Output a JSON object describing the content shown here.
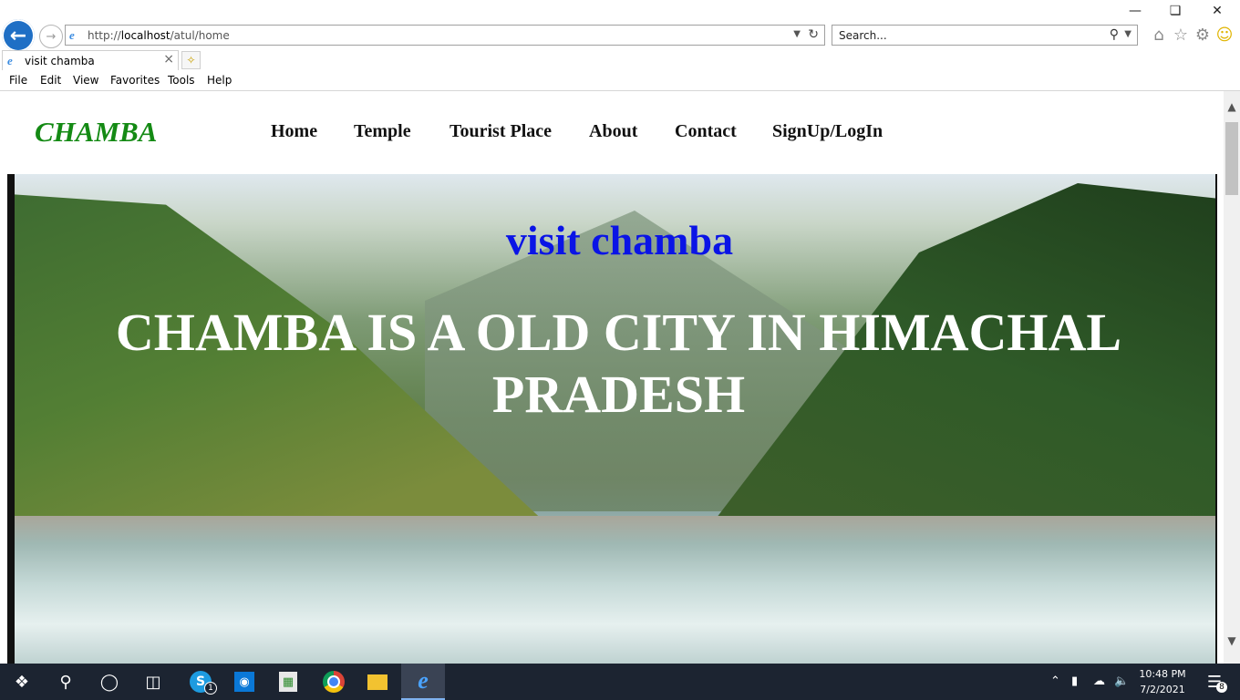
{
  "browser": {
    "address_url_prefix": "http://",
    "address_url_host": "localhost",
    "address_url_path": "/atul/home",
    "search_placeholder": "Search...",
    "tab_title": "visit chamba",
    "menu": [
      "File",
      "Edit",
      "View",
      "Favorites",
      "Tools",
      "Help"
    ]
  },
  "site": {
    "brand": "CHAMBA",
    "nav": [
      "Home",
      "Temple",
      "Tourist Place",
      "About",
      "Contact",
      "SignUp/LogIn"
    ],
    "hero_title": "visit chamba",
    "hero_text": "CHAMBA IS A OLD CITY IN HIMACHAL PRADESH"
  },
  "taskbar": {
    "time": "10:48 PM",
    "date": "7/2/2021",
    "notification_count": "8",
    "skype_badge": "1"
  },
  "colors": {
    "brand": "#148a14",
    "hero_title": "#0a14e6",
    "taskbar": "#1c2431"
  }
}
